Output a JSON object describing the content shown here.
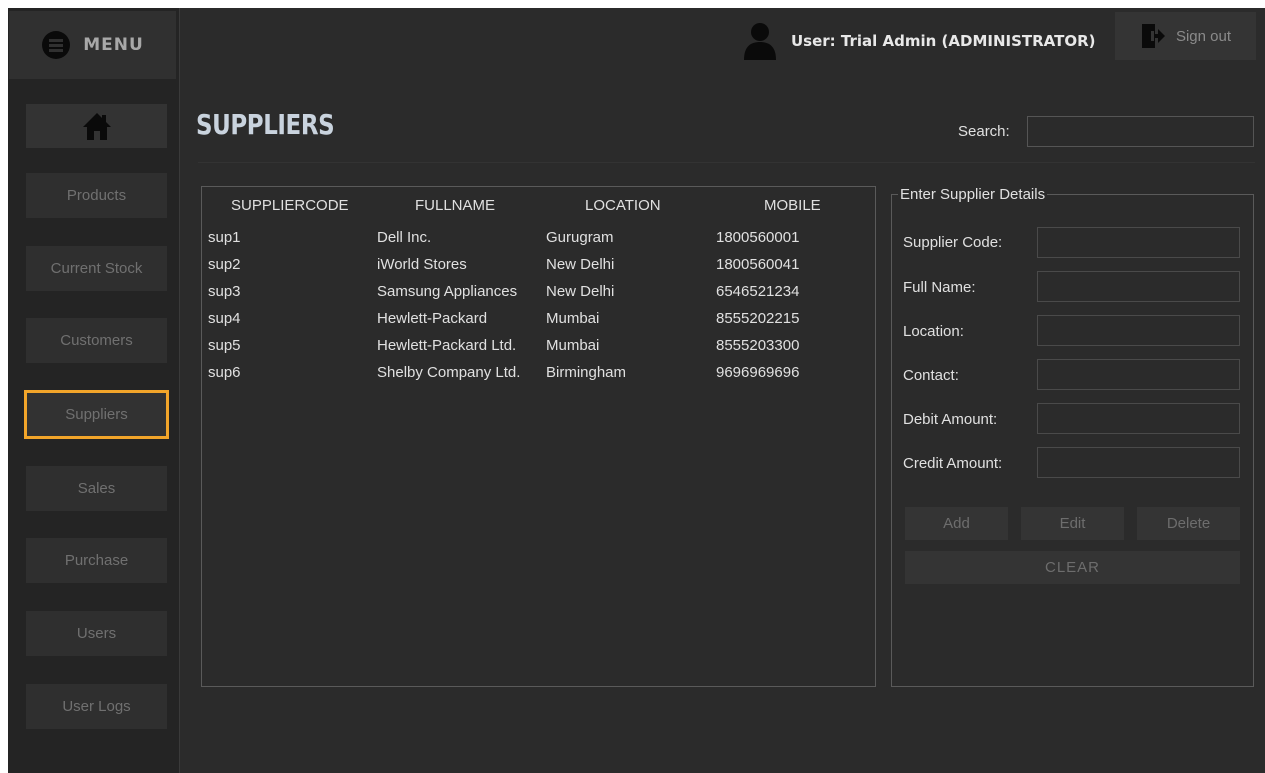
{
  "sidebar": {
    "menu_label": "MENU",
    "items": [
      {
        "label": "Products"
      },
      {
        "label": "Current Stock"
      },
      {
        "label": "Customers"
      },
      {
        "label": "Suppliers",
        "active": true
      },
      {
        "label": "Sales"
      },
      {
        "label": "Purchase"
      },
      {
        "label": "Users"
      },
      {
        "label": "User Logs"
      }
    ]
  },
  "header": {
    "user_text": "User: Trial Admin (ADMINISTRATOR)",
    "signout_label": "Sign out"
  },
  "page": {
    "title": "SUPPLIERS",
    "search_label": "Search:",
    "search_value": ""
  },
  "table": {
    "columns": [
      "SUPPLIERCODE",
      "FULLNAME",
      "LOCATION",
      "MOBILE"
    ],
    "rows": [
      [
        "sup1",
        "Dell Inc.",
        "Gurugram",
        "1800560001"
      ],
      [
        "sup2",
        "iWorld Stores",
        "New Delhi",
        "1800560041"
      ],
      [
        "sup3",
        "Samsung Appliances",
        "New Delhi",
        "6546521234"
      ],
      [
        "sup4",
        "Hewlett-Packard",
        "Mumbai",
        "8555202215"
      ],
      [
        "sup5",
        "Hewlett-Packard Ltd.",
        "Mumbai",
        "8555203300"
      ],
      [
        "sup6",
        "Shelby Company Ltd.",
        "Birmingham",
        "9696969696"
      ]
    ]
  },
  "form": {
    "legend": "Enter Supplier Details",
    "fields": [
      {
        "label": "Supplier Code:",
        "value": ""
      },
      {
        "label": "Full Name:",
        "value": ""
      },
      {
        "label": "Location:",
        "value": ""
      },
      {
        "label": "Contact:",
        "value": ""
      },
      {
        "label": "Debit Amount:",
        "value": ""
      },
      {
        "label": "Credit Amount:",
        "value": ""
      }
    ],
    "add_label": "Add",
    "edit_label": "Edit",
    "delete_label": "Delete",
    "clear_label": "CLEAR"
  },
  "colors": {
    "background": "#2b2b2b",
    "sidebar": "#242424",
    "active_border": "#f2a52a",
    "title": "#c9d3de"
  },
  "icons": [
    "menu-icon",
    "home-icon",
    "user-icon",
    "sign-out-icon"
  ]
}
